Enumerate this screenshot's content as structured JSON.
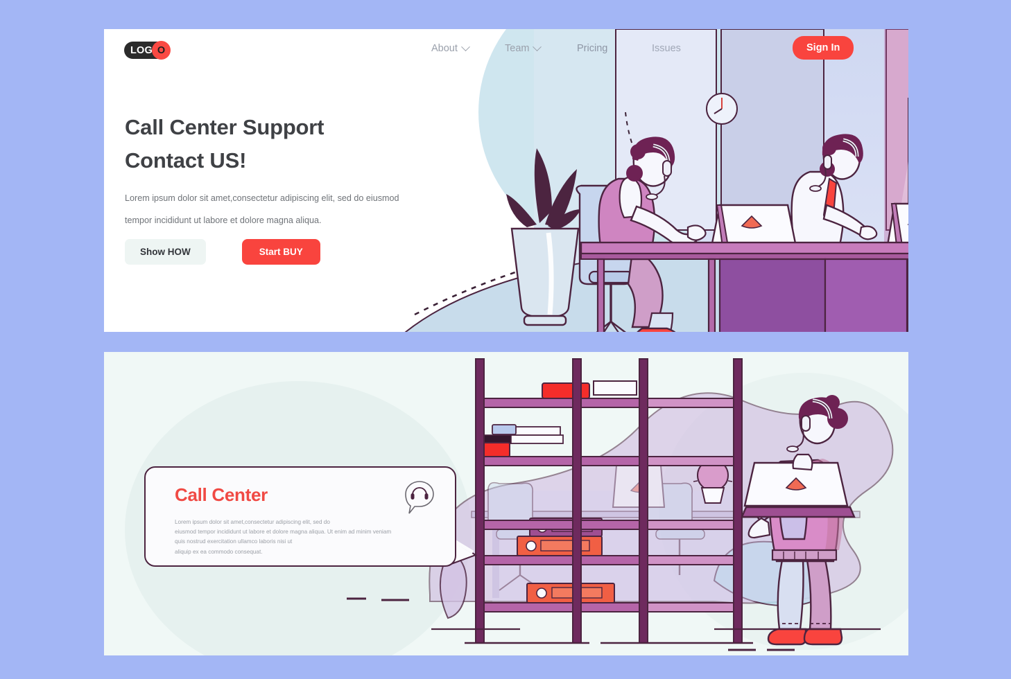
{
  "brand": {
    "logo_main": "LOG",
    "logo_mark": "O",
    "accent_red": "#f9443e",
    "page_bg": "#a3b6f5",
    "panel_bg": "#ffffff",
    "card_panel_bg": "#f0f8f6",
    "heading_color": "#3f4145",
    "muted_text": "#9aa0ab"
  },
  "nav": {
    "items": [
      {
        "label": "About",
        "has_dropdown": true
      },
      {
        "label": "Team",
        "has_dropdown": true
      },
      {
        "label": "Pricing",
        "has_dropdown": false
      },
      {
        "label": "Issues",
        "has_dropdown": false
      }
    ],
    "signin_label": "Sign In"
  },
  "hero": {
    "title_line1": "Call Center Support",
    "title_line2": "Contact US!",
    "paragraph": "Lorem ipsum dolor sit amet,consectetur adipiscing elit, sed do eiusmod tempor incididunt ut labore et dolore magna aliqua.",
    "button_secondary": "Show HOW",
    "button_primary": "Start BUY"
  },
  "card": {
    "title": "Call Center",
    "paragraph_line1": "Lorem ipsum dolor sit amet,consectetur adipiscing elit, sed do",
    "paragraph_line2": "eiusmod tempor incididunt ut labore et dolore magna aliqua. Ut enim ad minim veniam",
    "paragraph_line3": "quis nostrud exercitation ullamco laboris nisi ut",
    "paragraph_line4": "aliquip ex ea commodo consequat.",
    "icon": "headset-speech-bubble-icon"
  },
  "illustration": {
    "hero_scene": "call-center-office-two-agents",
    "card_scene": "standing-agent-with-laptop-bookshelf",
    "laptop_logo": "red-triangle-logo",
    "wall_clock": "analog-clock",
    "plant": "potted-plant",
    "cabinet": "filing-cabinet-six-drawers",
    "shelf_items": "books-binders-cactus"
  }
}
